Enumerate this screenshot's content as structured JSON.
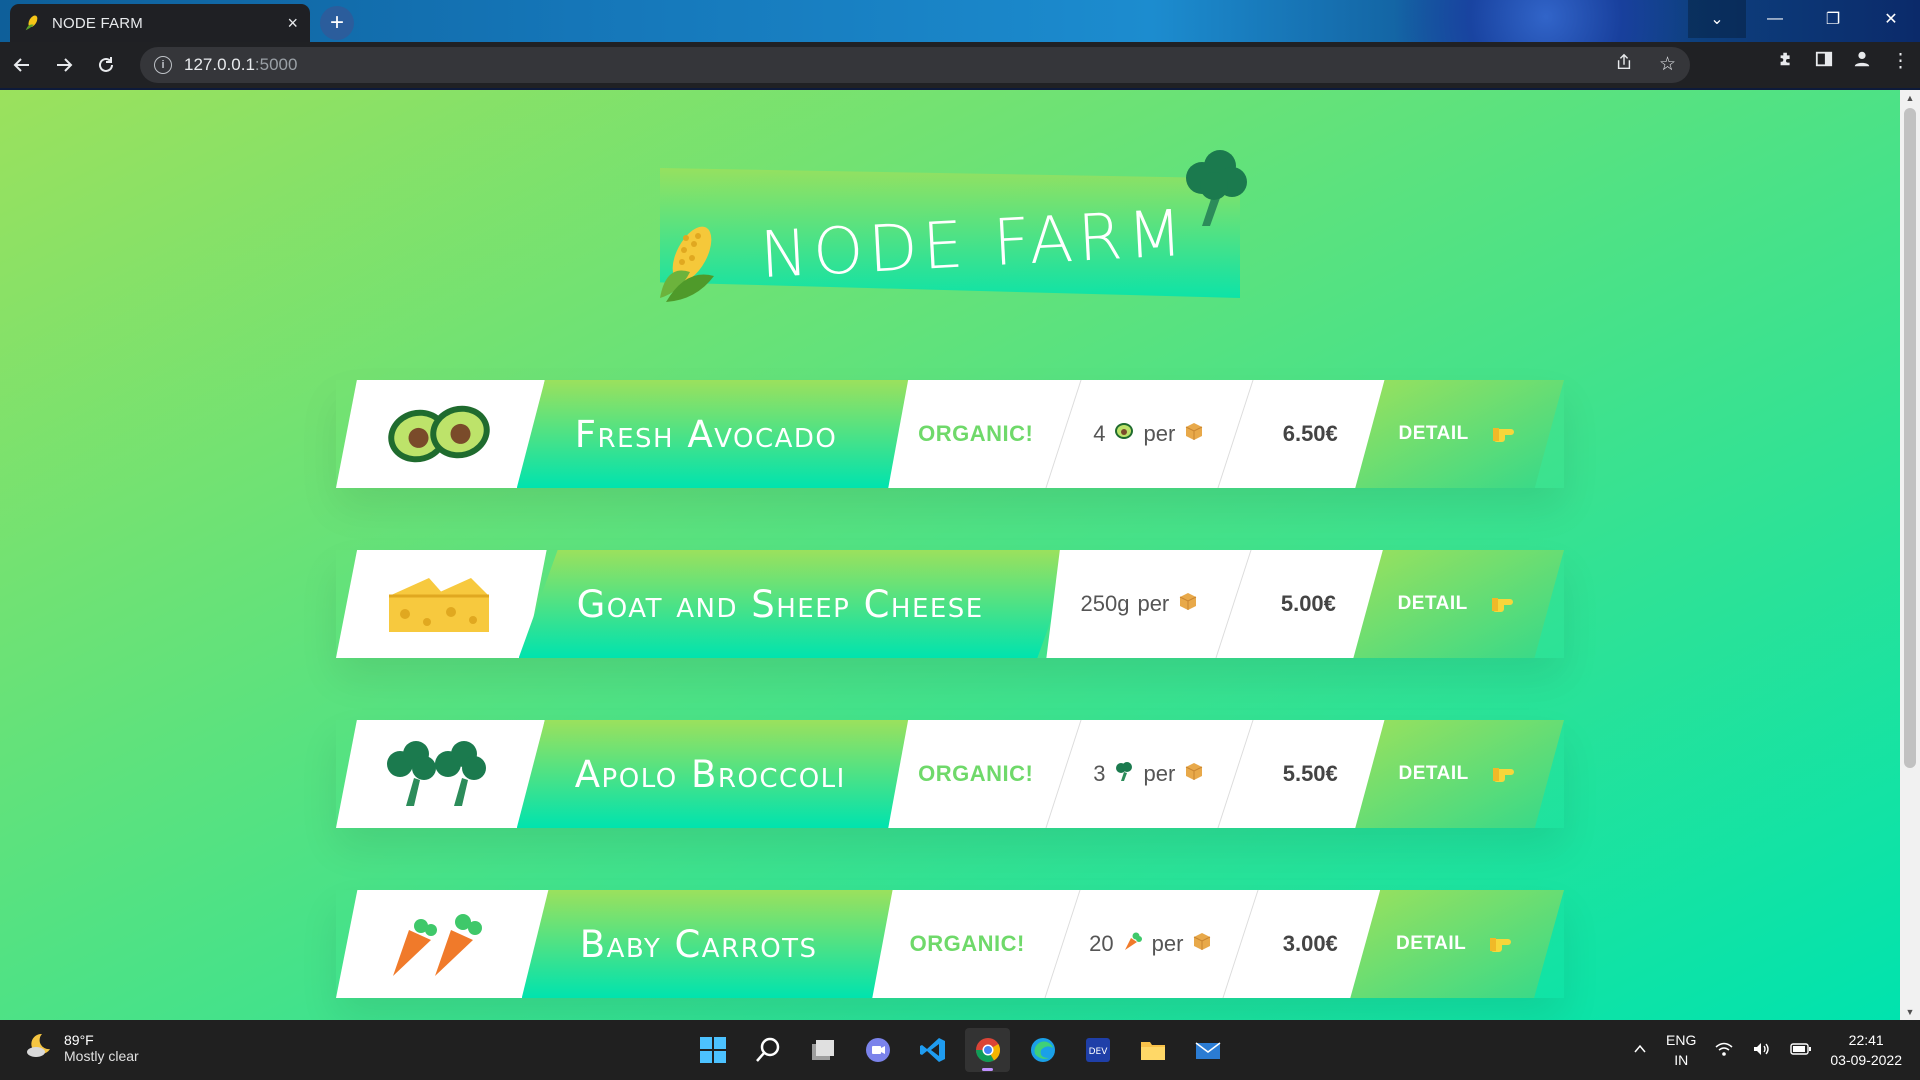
{
  "browser": {
    "tab_title": "NODE FARM",
    "tab_close": "×",
    "new_tab": "+",
    "url_host": "127.0.0.1",
    "url_port": ":5000",
    "window_controls": [
      "⌄",
      "—",
      "❐",
      "✕"
    ]
  },
  "page": {
    "logo_title": "NODE FARM",
    "products": [
      {
        "name": "Fresh Avocado",
        "organic": "ORGANIC!",
        "qty": "4",
        "per": "per",
        "price": "6.50€",
        "detail": "DETAIL",
        "icon": "avocado-icon"
      },
      {
        "name": "Goat and Sheep Cheese",
        "organic": "",
        "qty": "250g",
        "per": "per",
        "price": "5.00€",
        "detail": "DETAIL",
        "icon": "cheese-icon"
      },
      {
        "name": "Apolo Broccoli",
        "organic": "ORGANIC!",
        "qty": "3",
        "per": "per",
        "price": "5.50€",
        "detail": "DETAIL",
        "icon": "broccoli-icon"
      },
      {
        "name": "Baby Carrots",
        "organic": "ORGANIC!",
        "qty": "20",
        "per": "per",
        "price": "3.00€",
        "detail": "DETAIL",
        "icon": "carrot-icon"
      }
    ]
  },
  "taskbar": {
    "temperature": "89°F",
    "condition": "Mostly clear",
    "lang_top": "ENG",
    "lang_bottom": "IN",
    "time": "22:41",
    "date": "03-09-2022"
  },
  "colors": {
    "gradient_start": "#9be15d",
    "gradient_end": "#00e3ae",
    "organic_green": "#6fd96a"
  }
}
